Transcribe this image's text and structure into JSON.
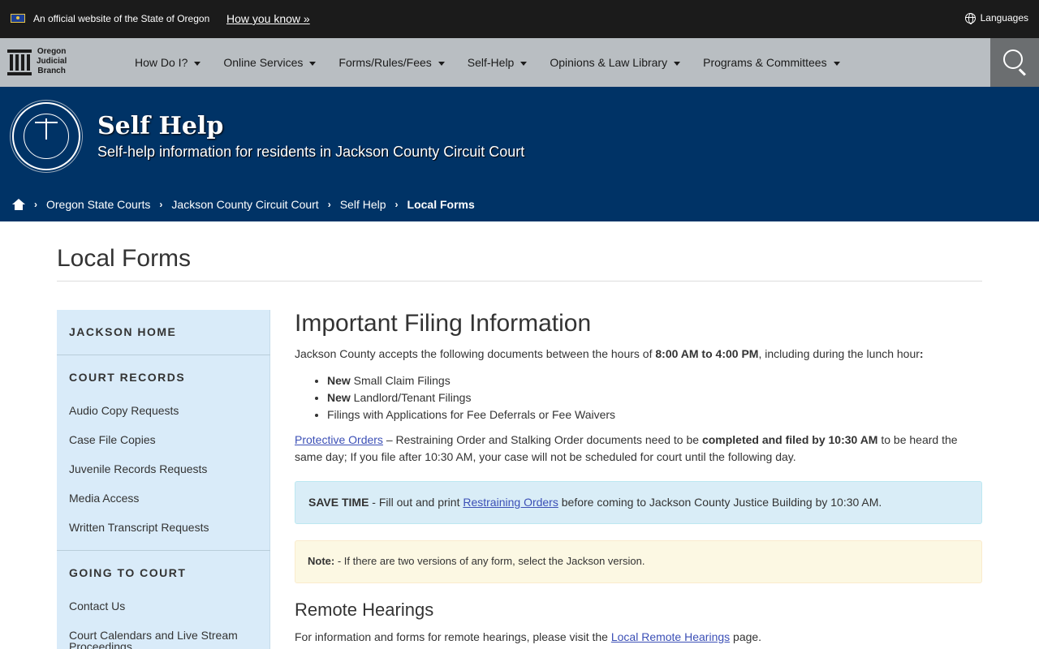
{
  "topbar": {
    "official_text": "An official website of the State of Oregon",
    "how_you_know": "How you know »",
    "languages": "Languages"
  },
  "nav": {
    "logo_line1": "Oregon",
    "logo_line2": "Judicial",
    "logo_line3": "Branch",
    "items": [
      {
        "label": "How Do I?"
      },
      {
        "label": "Online Services"
      },
      {
        "label": "Forms/Rules/Fees"
      },
      {
        "label": "Self-Help"
      },
      {
        "label": "Opinions & Law Library"
      },
      {
        "label": "Programs & Committees"
      }
    ]
  },
  "hero": {
    "seal_text": "JUDICIAL DEPARTMENT · STATE OF OREGON",
    "title": "Self Help",
    "subtitle": "Self-help information for residents in Jackson County Circuit Court"
  },
  "breadcrumb": {
    "items": [
      "Oregon State Courts",
      "Jackson County Circuit Court",
      "Self Help"
    ],
    "current": "Local Forms"
  },
  "page": {
    "title": "Local Forms"
  },
  "sidebar": {
    "sections": [
      {
        "heading": "JACKSON HOME"
      },
      {
        "heading": "COURT RECORDS",
        "links": [
          "Audio Copy Requests",
          "Case File Copies",
          "Juvenile Records Requests",
          "Media Access",
          "Written Transcript Requests"
        ]
      },
      {
        "heading": "GOING TO COURT",
        "links": [
          "Contact Us",
          "Court Calendars and Live Stream Proceedings"
        ]
      }
    ]
  },
  "main": {
    "heading": "Important Filing Information",
    "intro_pre": "Jackson County accepts the following documents between the hours of ",
    "intro_hours": "8:00 AM to 4:00 PM",
    "intro_post": ", including during the lunch hour",
    "intro_colon": ":",
    "list": [
      {
        "bold": "New",
        "text": " Small Claim Filings"
      },
      {
        "bold": "New",
        "text": " Landlord/Tenant Filings"
      },
      {
        "bold": "",
        "text": "Filings with Applications for Fee Deferrals or Fee Waivers"
      }
    ],
    "protective_link": "Protective Orders",
    "protective_pre": " – Restraining Order and Stalking Order documents need to be ",
    "protective_bold": "completed and filed by 10:30 AM",
    "protective_post": " to be heard the same day; If you file after 10:30 AM, your case will not be scheduled for court until the following day.",
    "save_time_bold": "SAVE TIME",
    "save_time_pre": " - Fill out and print ",
    "save_time_link": "Restraining Orders",
    "save_time_post": " before coming to Jackson County Justice Building by 10:30 AM.",
    "note_bold": "Note:",
    "note_text": " - If there are two versions of any form, select the Jackson version.",
    "remote_heading": "Remote Hearings",
    "remote_pre": "For information and forms for remote hearings, please visit the ",
    "remote_link": "Local Remote Hearings",
    "remote_post": " page."
  }
}
